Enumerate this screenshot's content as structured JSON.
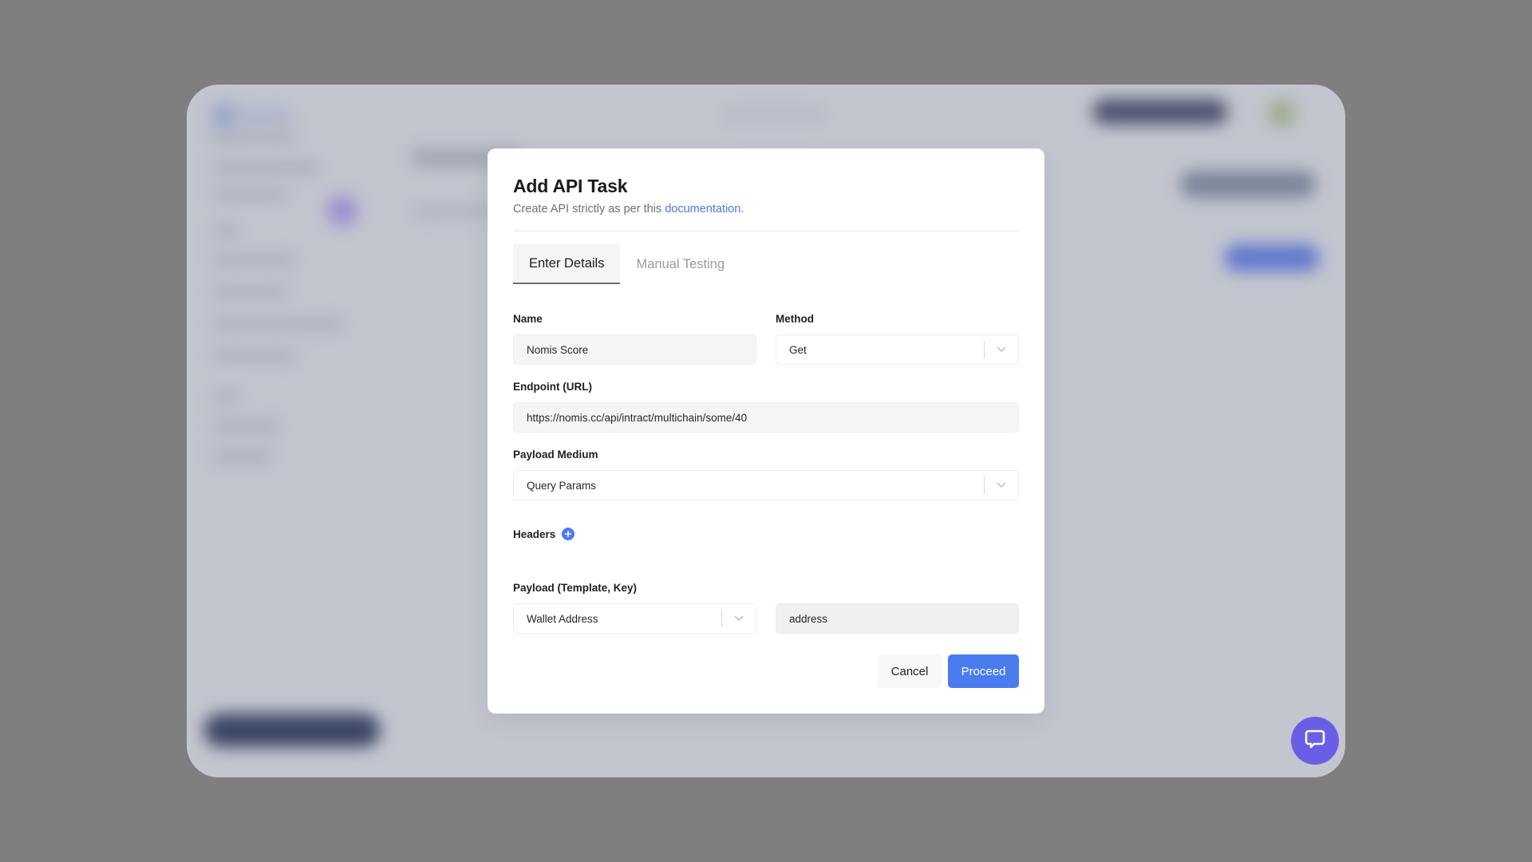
{
  "modal": {
    "title": "Add API Task",
    "subtitle_prefix": "Create API strictly as per this ",
    "subtitle_link": "documentation",
    "subtitle_suffix": ".",
    "tabs": [
      {
        "label": "Enter Details",
        "active": true
      },
      {
        "label": "Manual Testing",
        "active": false
      }
    ],
    "fields": {
      "name": {
        "label": "Name",
        "value": "Nomis Score"
      },
      "method": {
        "label": "Method",
        "value": "Get",
        "icon": "chevron-down-icon"
      },
      "endpoint": {
        "label": "Endpoint (URL)",
        "value": "https://nomis.cc/api/intract/multichain/some/40"
      },
      "payload_medium": {
        "label": "Payload Medium",
        "value": "Query Params",
        "icon": "chevron-down-icon"
      },
      "headers": {
        "label": "Headers",
        "add_icon": "plus-circle-icon"
      },
      "payload": {
        "label": "Payload (Template, Key)",
        "template_value": "Wallet Address",
        "key_value": "address"
      }
    },
    "buttons": {
      "cancel": "Cancel",
      "proceed": "Proceed"
    }
  },
  "chat_widget": {
    "icon": "chat-bubble-icon"
  },
  "colors": {
    "accent": "#4a7cf0",
    "link": "#4a77e8",
    "chat": "#6b5ee6",
    "overlay_bg": "#7f7f7f"
  }
}
